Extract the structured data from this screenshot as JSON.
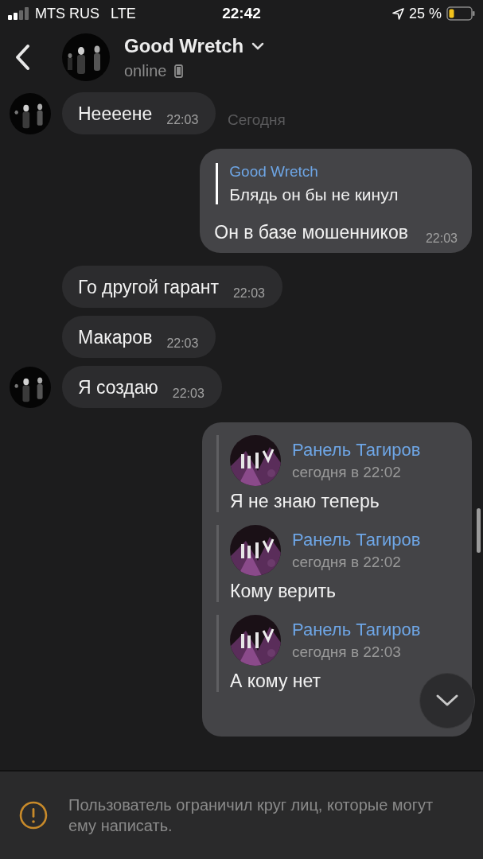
{
  "status_bar": {
    "carrier": "MTS RUS",
    "network": "LTE",
    "time": "22:42",
    "battery": "25 %"
  },
  "header": {
    "title": "Good Wretch",
    "status": "online"
  },
  "date_label": "Сегодня",
  "messages": [
    {
      "kind": "in",
      "avatar": true,
      "text": "Неееене",
      "time": "22:03"
    },
    {
      "kind": "out",
      "reply": {
        "author": "Good Wretch",
        "text": "Блядь он бы не кинул"
      },
      "text": "Он в базе мошенников",
      "time": "22:03"
    },
    {
      "kind": "in",
      "avatar": false,
      "text": "Го другой гарант",
      "time": "22:03"
    },
    {
      "kind": "in",
      "avatar": false,
      "text": "Макаров",
      "time": "22:03"
    },
    {
      "kind": "in",
      "avatar": true,
      "text": "Я создаю",
      "time": "22:03"
    },
    {
      "kind": "forward",
      "items": [
        {
          "author": "Ранель Тагиров",
          "date": "сегодня в 22:02",
          "text": "Я не знаю теперь"
        },
        {
          "author": "Ранель Тагиров",
          "date": "сегодня в 22:02",
          "text": "Кому верить"
        },
        {
          "author": "Ранель Тагиров",
          "date": "сегодня в 22:03",
          "text": "А кому нет"
        }
      ]
    }
  ],
  "notice": "Пользователь ограничил круг лиц, которые могут ему написать."
}
